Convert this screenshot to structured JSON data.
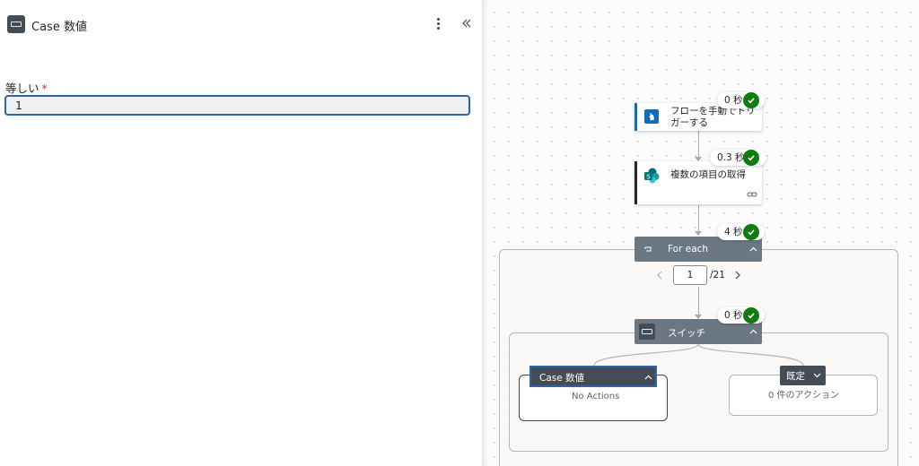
{
  "panel": {
    "title": "Case 数値",
    "field_label": "等しい",
    "required_mark": "*",
    "field_value": "1"
  },
  "canvas": {
    "trigger": {
      "badge": "0 秒",
      "title": "フローを手動でトリガーする"
    },
    "get_items": {
      "badge": "0.3 秒",
      "title": "複数の項目の取得"
    },
    "foreach": {
      "badge": "4 秒",
      "title": "For each",
      "page_value": "1",
      "page_total": "/21"
    },
    "switch": {
      "badge": "0 秒",
      "title": "スイッチ"
    },
    "case": {
      "title": "Case 数値",
      "empty_text": "No Actions"
    },
    "default": {
      "title": "既定",
      "empty_text": "0 件のアクション"
    }
  },
  "colors": {
    "accent": "#2e63a8",
    "success": "#107c10",
    "header_dark": "#444c55",
    "header_slate": "#6b7883",
    "required": "#c4314b"
  }
}
